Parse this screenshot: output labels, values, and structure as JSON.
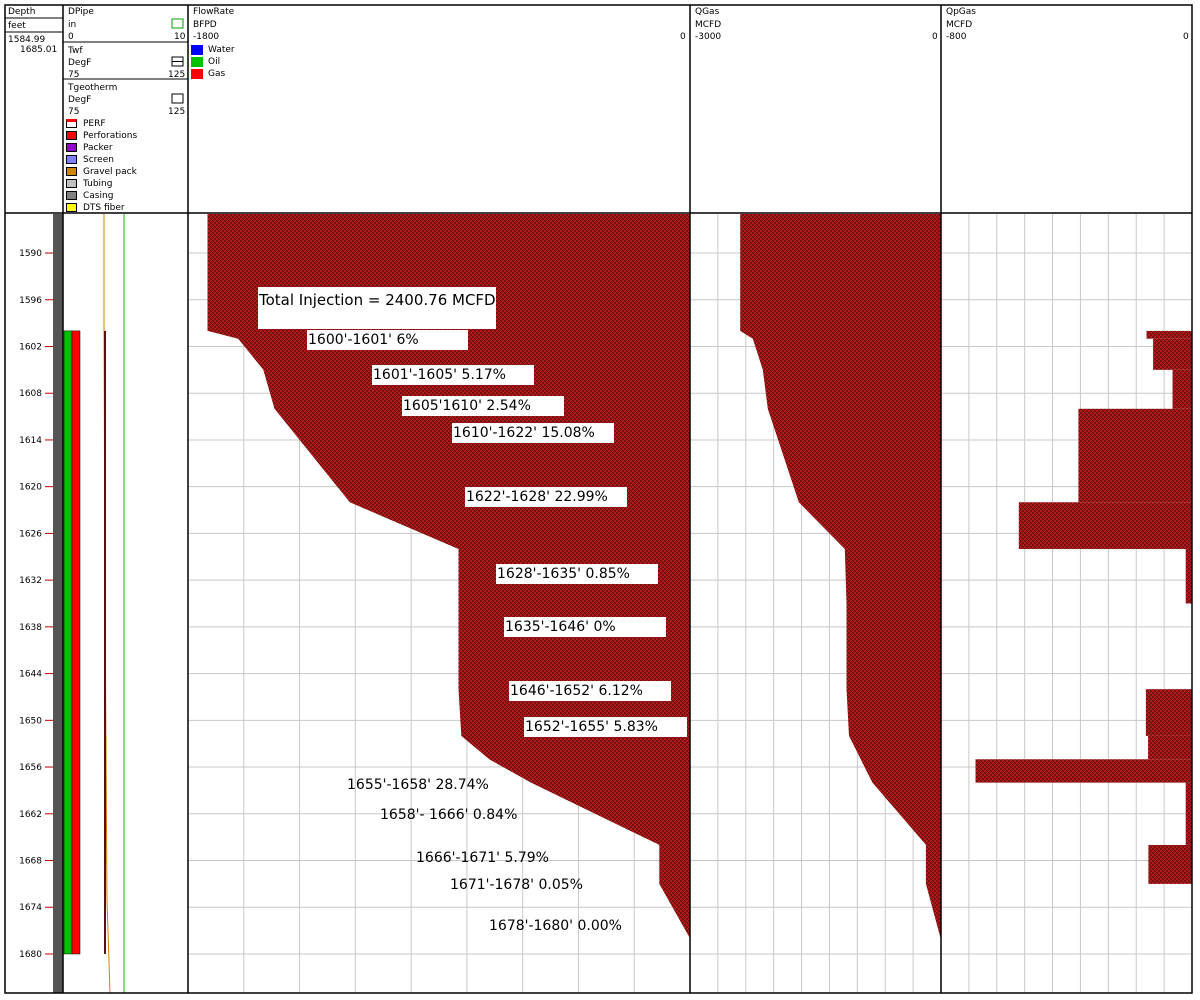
{
  "header": {
    "depth": {
      "title": "Depth",
      "unit": "feet",
      "top": "1584.99",
      "bottom": "1685.01"
    },
    "dpipe": {
      "title": "DPipe",
      "unit": "in",
      "min": "0",
      "max": "10"
    },
    "twf": {
      "title": "Twf",
      "unit": "DegF",
      "min": "75",
      "max": "125"
    },
    "tgeotherm": {
      "title": "Tgeotherm",
      "unit": "DegF",
      "min": "75",
      "max": "125"
    },
    "completion_legend": [
      {
        "label": "PERF",
        "color": "#ffffff"
      },
      {
        "label": "Perforations",
        "color": "#ff0000"
      },
      {
        "label": "Packer",
        "color": "#9900cc"
      },
      {
        "label": "Screen",
        "color": "#7f7fff"
      },
      {
        "label": "Gravel pack",
        "color": "#cc8800"
      },
      {
        "label": "Tubing",
        "color": "#c0c0c0"
      },
      {
        "label": "Casing",
        "color": "#808080"
      },
      {
        "label": "DTS fiber",
        "color": "#ffff00"
      }
    ],
    "flowrate": {
      "title": "FlowRate",
      "unit": "BFPD",
      "min": "-1800",
      "max": "0",
      "legend": [
        {
          "label": "Water",
          "color": "#0000ff"
        },
        {
          "label": "Oil",
          "color": "#00c000"
        },
        {
          "label": "Gas",
          "color": "#ff0000"
        }
      ]
    },
    "qgas": {
      "title": "QGas",
      "unit": "MCFD",
      "min": "-3000",
      "max": "0"
    },
    "qpgas": {
      "title": "QpGas",
      "unit": "MCFD",
      "min": "-800",
      "max": "0"
    }
  },
  "chart_data": {
    "type": "area",
    "y_axis": {
      "label": "Depth",
      "unit": "feet",
      "range": [
        1584.99,
        1685.01
      ],
      "ticks": [
        1590,
        1596,
        1602,
        1608,
        1614,
        1620,
        1626,
        1632,
        1638,
        1644,
        1650,
        1656,
        1662,
        1668,
        1674,
        1680
      ]
    },
    "colors": {
      "fill": "#8b1515",
      "hatch": "#d42020",
      "grid": "#c8c8c8",
      "oil": "#00c000",
      "perf": "#ff0000",
      "casing": "#555555",
      "twf": "#d08000",
      "tgeo": "#00c000"
    },
    "tracks": [
      {
        "name": "FlowRate",
        "unit": "BFPD",
        "xlim": [
          -1800,
          0
        ],
        "series": [
          {
            "label": "Gas",
            "points": [
              [
                1584.99,
                -1730
              ],
              [
                1600,
                -1730
              ],
              [
                1601,
                -1620
              ],
              [
                1605,
                -1530
              ],
              [
                1610,
                -1490
              ],
              [
                1622,
                -1220
              ],
              [
                1628,
                -830
              ],
              [
                1635,
                -830
              ],
              [
                1646,
                -830
              ],
              [
                1652,
                -820
              ],
              [
                1655,
                -720
              ],
              [
                1658,
                -570
              ],
              [
                1666,
                -110
              ],
              [
                1671,
                -110
              ],
              [
                1678,
                0
              ],
              [
                1680,
                0
              ],
              [
                1685.01,
                0
              ]
            ]
          }
        ]
      },
      {
        "name": "QGas",
        "unit": "MCFD",
        "xlim": [
          -3000,
          0
        ],
        "series": [
          {
            "label": "QGas",
            "points": [
              [
                1584.99,
                -2400
              ],
              [
                1600,
                -2400
              ],
              [
                1601,
                -2250
              ],
              [
                1605,
                -2130
              ],
              [
                1610,
                -2070
              ],
              [
                1622,
                -1700
              ],
              [
                1628,
                -1150
              ],
              [
                1635,
                -1130
              ],
              [
                1646,
                -1130
              ],
              [
                1652,
                -1100
              ],
              [
                1655,
                -960
              ],
              [
                1658,
                -820
              ],
              [
                1666,
                -180
              ],
              [
                1671,
                -180
              ],
              [
                1678,
                -5
              ],
              [
                1680,
                0
              ],
              [
                1685.01,
                0
              ]
            ]
          }
        ]
      },
      {
        "name": "QpGas",
        "unit": "MCFD",
        "xlim": [
          -800,
          0
        ],
        "series": [
          {
            "label": "QpGas",
            "steps": [
              [
                1600,
                1601,
                -145
              ],
              [
                1601,
                1605,
                -124
              ],
              [
                1605,
                1610,
                -62
              ],
              [
                1610,
                1622,
                -362
              ],
              [
                1622,
                1628,
                -552
              ],
              [
                1628,
                1635,
                -20
              ],
              [
                1635,
                1646,
                0
              ],
              [
                1646,
                1652,
                -147
              ],
              [
                1652,
                1655,
                -140
              ],
              [
                1655,
                1658,
                -690
              ],
              [
                1658,
                1666,
                -20
              ],
              [
                1666,
                1671,
                -139
              ],
              [
                1671,
                1678,
                -1
              ],
              [
                1678,
                1680,
                0
              ]
            ]
          }
        ]
      }
    ],
    "completion": {
      "oil_interval": [
        1600,
        1680
      ],
      "perforations_interval": [
        1600,
        1680
      ],
      "casing_interval": [
        1584.99,
        1685.01
      ]
    },
    "annotations": [
      {
        "text": "Total Injection = 2400.76 MCFD",
        "depth": 1597.1
      },
      {
        "text": "1600'-1601'  6%",
        "depth": 1601.2
      },
      {
        "text": "1601'-1605'   5.17%",
        "depth": 1605.7
      },
      {
        "text": "1605'1610'   2.54%",
        "depth": 1609.6
      },
      {
        "text": "1610'-1622'   15.08%",
        "depth": 1613.1
      },
      {
        "text": "1622'-1628'   22.99%",
        "depth": 1621.3
      },
      {
        "text": "1628'-1635'  0.85%",
        "depth": 1631.2
      },
      {
        "text": "1635'-1646'  0%",
        "depth": 1638.0
      },
      {
        "text": "1646'-1652'  6.12%",
        "depth": 1646.2
      },
      {
        "text": "1652'-1655'  5.83%",
        "depth": 1650.8
      },
      {
        "text": "1655'-1658'  28.74%",
        "depth": 1658.3
      },
      {
        "text": "1658'- 1666'  0.84%",
        "depth": 1662.2
      },
      {
        "text": "1666'-1671'  5.79%",
        "depth": 1667.7
      },
      {
        "text": "1671'-1678'   0.05%",
        "depth": 1671.1
      },
      {
        "text": "1678'-1680'   0.00%",
        "depth": 1676.4
      }
    ]
  }
}
